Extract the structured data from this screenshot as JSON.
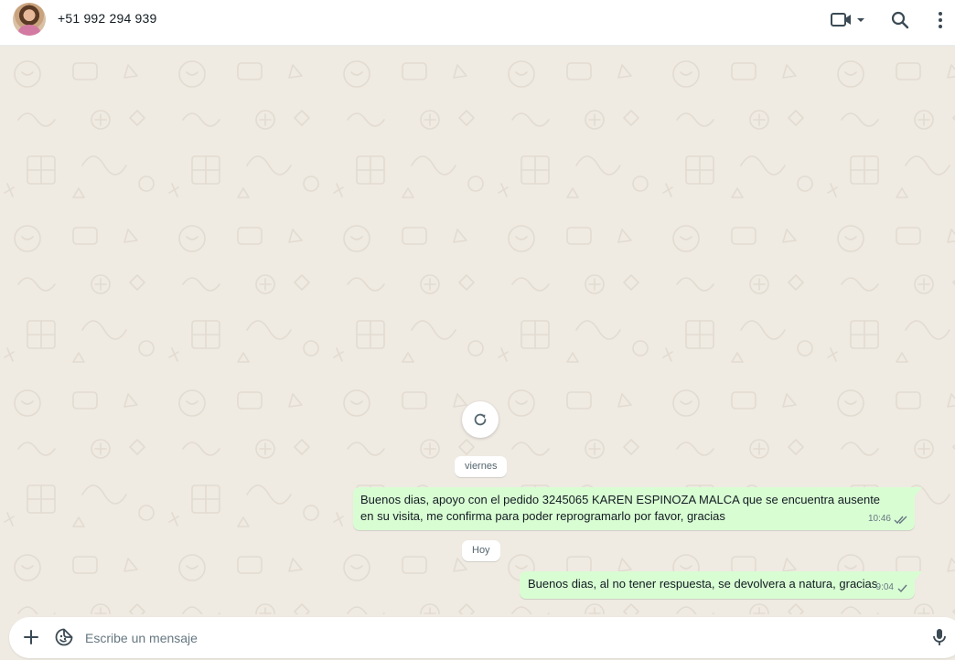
{
  "header": {
    "contact_name": "+51 992 294 939",
    "icons": [
      "avatar",
      "video-call-icon",
      "chevron-down-icon",
      "search-icon",
      "more-vertical-icon"
    ]
  },
  "chat": {
    "refresh_icon": "refresh-icon",
    "days": [
      {
        "label": "viernes",
        "messages": [
          {
            "direction": "outgoing",
            "text": "Buenos dias, apoyo con el pedido 3245065 KAREN ESPINOZA MALCA que se encuentra ausente en su visita, me confirma para poder reprogramarlo por favor, gracias",
            "time": "10:46",
            "status": "read-double-check"
          }
        ]
      },
      {
        "label": "Hoy",
        "messages": [
          {
            "direction": "outgoing",
            "text": "Buenos dias, al no tener respuesta, se devolvera a natura, gracias",
            "time": "9:04",
            "status": "sent-single-check"
          }
        ]
      }
    ]
  },
  "composer": {
    "placeholder": "Escribe un mensaje",
    "value": "",
    "icons": [
      "plus-icon",
      "sticker-icon",
      "microphone-icon"
    ]
  },
  "colors": {
    "header_bg": "#ffffff",
    "chat_bg": "#efeae2",
    "outgoing_bubble": "#d9fdd3",
    "meta_text": "#667781"
  }
}
